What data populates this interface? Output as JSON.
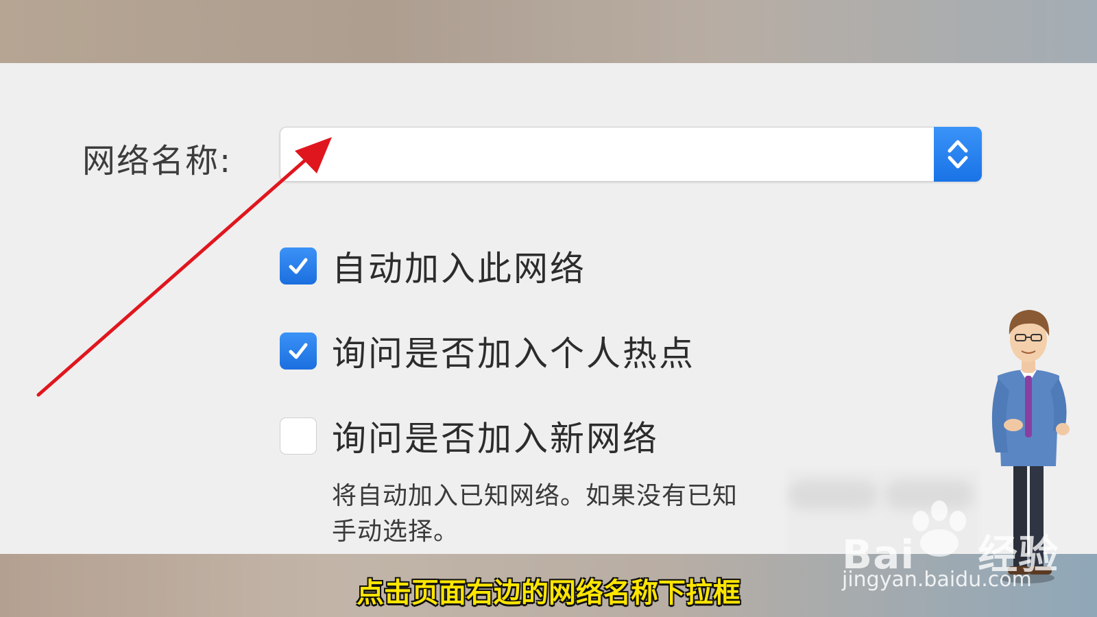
{
  "dialog": {
    "network_name_label": "网络名称:",
    "network_name_value": "",
    "options": [
      {
        "label": "自动加入此网络",
        "checked": true
      },
      {
        "label": "询问是否加入个人热点",
        "checked": true
      },
      {
        "label": "询问是否加入新网络",
        "checked": false
      }
    ],
    "description_line1": "将自动加入已知网络。如果没有已知",
    "description_line2": "手动选择。"
  },
  "overlay": {
    "caption": "点击页面右边的网络名称下拉框",
    "watermark_brand": "Bai",
    "watermark_brand_suffix": "经验",
    "watermark_url": "jingyan.baidu.com",
    "arrow_color": "#e0161e"
  },
  "colors": {
    "accent": "#1a73e6",
    "caption_fill": "#ffe600"
  },
  "icons": {
    "stepper": "chevron-up-down-icon",
    "checkmark": "checkmark-icon",
    "annotation": "red-arrow-icon",
    "presenter": "presenter-avatar"
  }
}
